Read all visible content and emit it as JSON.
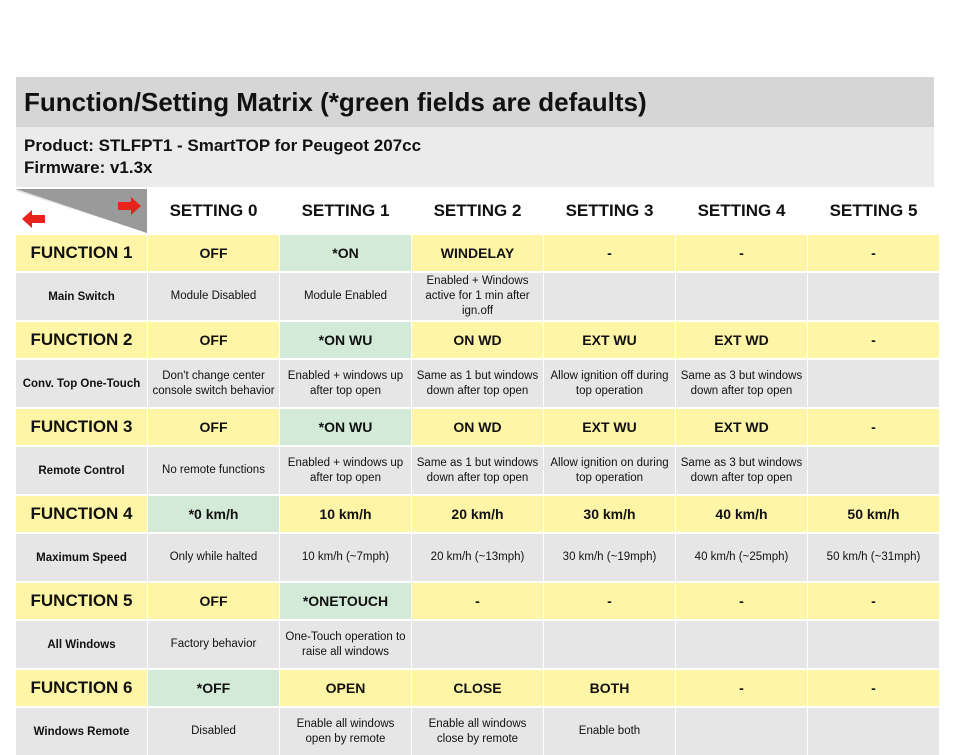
{
  "title": "Function/Setting Matrix (*green fields are defaults)",
  "product": "Product: STLFPT1 - SmartTOP for Peugeot 207cc",
  "firmware": "Firmware: v1.3x",
  "colors": {
    "title_bg": "#d6d6d6",
    "info_bg": "#ebebeb",
    "value_bg": "#fff5a6",
    "default_bg": "#d2ead7",
    "desc_bg": "#e6e6e6",
    "arrow": "#e8231c",
    "corner_wedge": "#8c8c8c"
  },
  "corner": {
    "left_icon": "red-left-arrow-icon",
    "right_icon": "red-right-arrow-icon"
  },
  "settings": [
    "SETTING 0",
    "SETTING 1",
    "SETTING 2",
    "SETTING 3",
    "SETTING 4",
    "SETTING 5"
  ],
  "functions": [
    {
      "name": "FUNCTION 1",
      "label": "Main Switch",
      "values": [
        "OFF",
        "*ON",
        "WINDELAY",
        "-",
        "-",
        "-"
      ],
      "default_index": 1,
      "descriptions": [
        "Module Disabled",
        "Module Enabled",
        "Enabled + Windows active for 1 min after ign.off",
        "",
        "",
        ""
      ]
    },
    {
      "name": "FUNCTION 2",
      "label": "Conv. Top One-Touch",
      "values": [
        "OFF",
        "*ON WU",
        "ON WD",
        "EXT WU",
        "EXT WD",
        "-"
      ],
      "default_index": 1,
      "descriptions": [
        "Don't change center console switch behavior",
        "Enabled + windows up after top open",
        "Same as 1 but windows down after top open",
        "Allow ignition off during top operation",
        "Same as 3 but windows down after top open",
        ""
      ]
    },
    {
      "name": "FUNCTION 3",
      "label": "Remote Control",
      "values": [
        "OFF",
        "*ON WU",
        "ON WD",
        "EXT WU",
        "EXT WD",
        "-"
      ],
      "default_index": 1,
      "descriptions": [
        "No remote functions",
        "Enabled + windows up after top open",
        "Same as 1 but windows down after top open",
        "Allow ignition on during top operation",
        "Same as 3 but windows down after top open",
        ""
      ]
    },
    {
      "name": "FUNCTION 4",
      "label": "Maximum Speed",
      "values": [
        "*0 km/h",
        "10 km/h",
        "20 km/h",
        "30 km/h",
        "40 km/h",
        "50 km/h"
      ],
      "default_index": 0,
      "descriptions": [
        "Only while halted",
        "10 km/h (~7mph)",
        "20 km/h (~13mph)",
        "30 km/h (~19mph)",
        "40 km/h (~25mph)",
        "50 km/h (~31mph)"
      ]
    },
    {
      "name": "FUNCTION 5",
      "label": "All Windows",
      "values": [
        "OFF",
        "*ONETOUCH",
        "-",
        "-",
        "-",
        "-"
      ],
      "default_index": 1,
      "descriptions": [
        "Factory behavior",
        "One-Touch operation to raise all windows",
        "",
        "",
        "",
        ""
      ]
    },
    {
      "name": "FUNCTION 6",
      "label": "Windows Remote",
      "values": [
        "*OFF",
        "OPEN",
        "CLOSE",
        "BOTH",
        "-",
        "-"
      ],
      "default_index": 0,
      "descriptions": [
        "Disabled",
        "Enable all windows open by remote",
        "Enable all windows close by remote",
        "Enable both",
        "",
        ""
      ]
    }
  ]
}
